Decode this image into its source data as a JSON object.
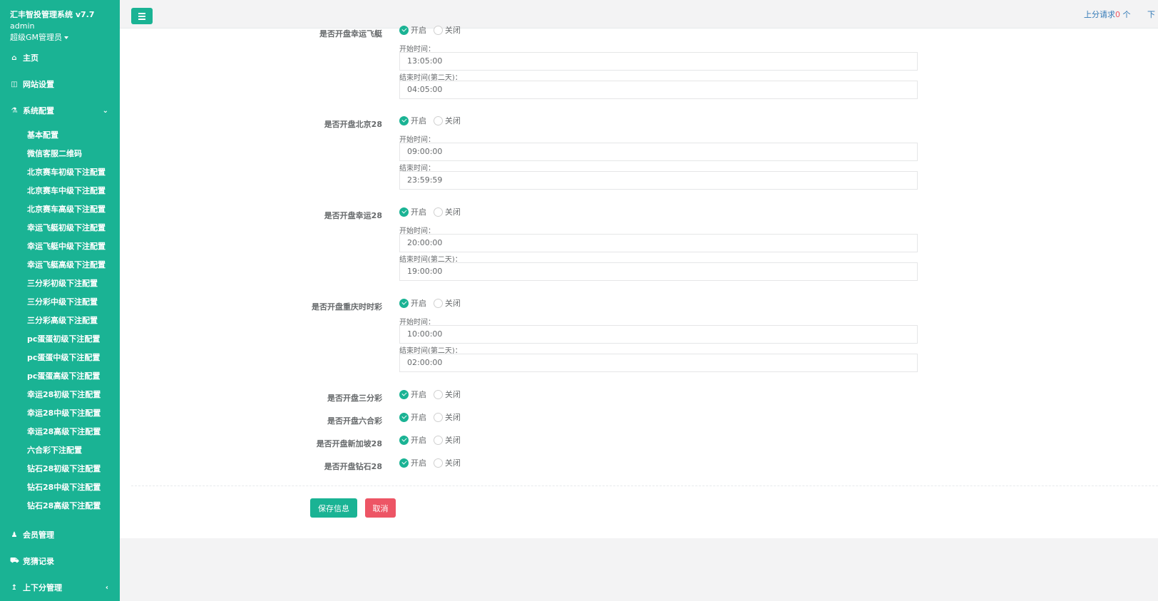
{
  "app": {
    "title": "汇丰智投管理系统 v7.7",
    "user": "admin",
    "role": "超级GM管理员"
  },
  "sidebar": {
    "items": [
      {
        "icon": "home-icon",
        "glyph": "⌂",
        "label": "主页"
      },
      {
        "icon": "columns-icon",
        "glyph": "◫",
        "label": "网站设置"
      },
      {
        "icon": "flask-icon",
        "glyph": "⚗",
        "label": "系统配置",
        "arrow": "⌄"
      },
      {
        "icon": "user-icon",
        "glyph": "♟",
        "label": "会员管理"
      },
      {
        "icon": "car-icon",
        "glyph": "⛟",
        "label": "竞猜记录"
      },
      {
        "icon": "upload-icon",
        "glyph": "↥",
        "label": "上下分管理",
        "arrow": "‹"
      }
    ],
    "subitems": [
      "基本配置",
      "微信客服二维码",
      "北京赛车初级下注配置",
      "北京赛车中级下注配置",
      "北京赛车高级下注配置",
      "幸运飞艇初级下注配置",
      "幸运飞艇中级下注配置",
      "幸运飞艇高级下注配置",
      "三分彩初级下注配置",
      "三分彩中级下注配置",
      "三分彩高级下注配置",
      "pc蛋蛋初级下注配置",
      "pc蛋蛋中级下注配置",
      "pc蛋蛋高级下注配置",
      "幸运28初级下注配置",
      "幸运28中级下注配置",
      "幸运28高级下注配置",
      "六合彩下注配置",
      "钻石28初级下注配置",
      "钻石28中级下注配置",
      "钻石28高级下注配置"
    ]
  },
  "topbar": {
    "request_prefix": "上分请求",
    "request_count": "0",
    "request_suffix": " 个",
    "down_label": "下"
  },
  "form": {
    "on_label": "开启",
    "off_label": "关闭",
    "rows": [
      {
        "label": "是否开盘幸运飞艇",
        "enabled": true,
        "start_label": "开始时间：",
        "start": "13:05:00",
        "end_label": "结束时间(第二天)：",
        "end": "04:05:00"
      },
      {
        "label": "是否开盘北京28",
        "enabled": true,
        "start_label": "开始时间：",
        "start": "09:00:00",
        "end_label": "结束时间：",
        "end": "23:59:59"
      },
      {
        "label": "是否开盘幸运28",
        "enabled": true,
        "start_label": "开始时间：",
        "start": "20:00:00",
        "end_label": "结束时间(第二天)：",
        "end": "19:00:00"
      },
      {
        "label": "是否开盘重庆时时彩",
        "enabled": true,
        "start_label": "开始时间：",
        "start": "10:00:00",
        "end_label": "结束时间(第二天)：",
        "end": "02:00:00"
      },
      {
        "label": "是否开盘三分彩",
        "enabled": true
      },
      {
        "label": "是否开盘六合彩",
        "enabled": true
      },
      {
        "label": "是否开盘新加坡28",
        "enabled": true
      },
      {
        "label": "是否开盘钻石28",
        "enabled": true
      }
    ],
    "save_label": "保存信息",
    "cancel_label": "取消"
  }
}
